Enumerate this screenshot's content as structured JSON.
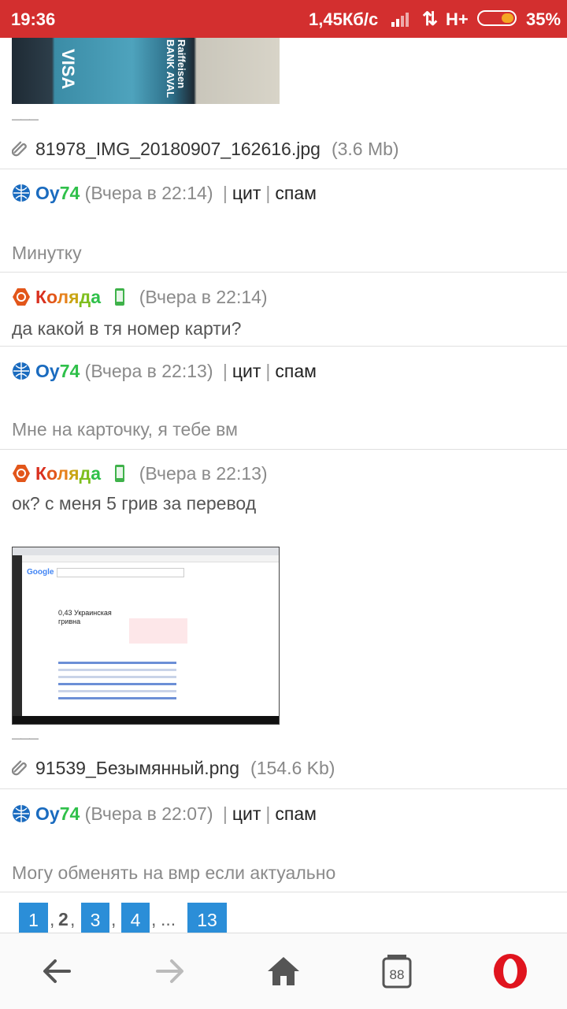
{
  "status": {
    "time": "19:36",
    "speed": "1,45Кб/с",
    "network": "H+",
    "battery": "35%",
    "battery_level": 0.35
  },
  "attachments": [
    {
      "name": "81978_IMG_20180907_162616.jpg",
      "size": "(3.6  Mb)",
      "thumb_text": [
        "VISA",
        "Raiffeisen",
        "BANK AVAL"
      ]
    },
    {
      "name": "91539_Безымянный.png",
      "size": "(154.6  Kb)",
      "thumb_text": [
        "Google",
        "0,43 Украинская",
        "гривна"
      ]
    }
  ],
  "posts": [
    {
      "nick_a": "Оу",
      "nick_b": "74",
      "date": "(Вчера  в  22:14)",
      "quote": "цит",
      "spam": "спам",
      "text": "Минутку"
    },
    {
      "nick": "Коляда",
      "date": "(Вчера  в  22:14)",
      "text": "да какой в тя номер карти?"
    },
    {
      "nick_a": "Оу",
      "nick_b": "74",
      "date": "(Вчера  в  22:13)",
      "quote": "цит",
      "spam": "спам",
      "text": "Мне на карточку,  я тебе вм"
    },
    {
      "nick": "Коляда",
      "date": "(Вчера  в  22:13)",
      "text": "ок?  с меня 5 грив за перевод"
    },
    {
      "nick_a": "Оу",
      "nick_b": "74",
      "date": "(Вчера  в  22:07)",
      "quote": "цит",
      "spam": "спам",
      "text": "Могу обменять  на вмр если актуально"
    }
  ],
  "pager": {
    "p1": "1",
    "p2": "2",
    "p3": "3",
    "p4": "4",
    "ellipsis": "...",
    "last": "13",
    "comma": ","
  },
  "dash": "———",
  "sep_bar": "|",
  "kolyada_letters": [
    {
      "ch": "К",
      "color": "#d9301f"
    },
    {
      "ch": "о",
      "color": "#e2561a"
    },
    {
      "ch": "л",
      "color": "#e6801a"
    },
    {
      "ch": "я",
      "color": "#c9a514"
    },
    {
      "ch": "д",
      "color": "#7fbf1f"
    },
    {
      "ch": "а",
      "color": "#2fc04a"
    }
  ],
  "colors": {
    "statusbar": "#d32f2f",
    "link_blue": "#2b8ed8",
    "opera_red": "#e0141e"
  }
}
